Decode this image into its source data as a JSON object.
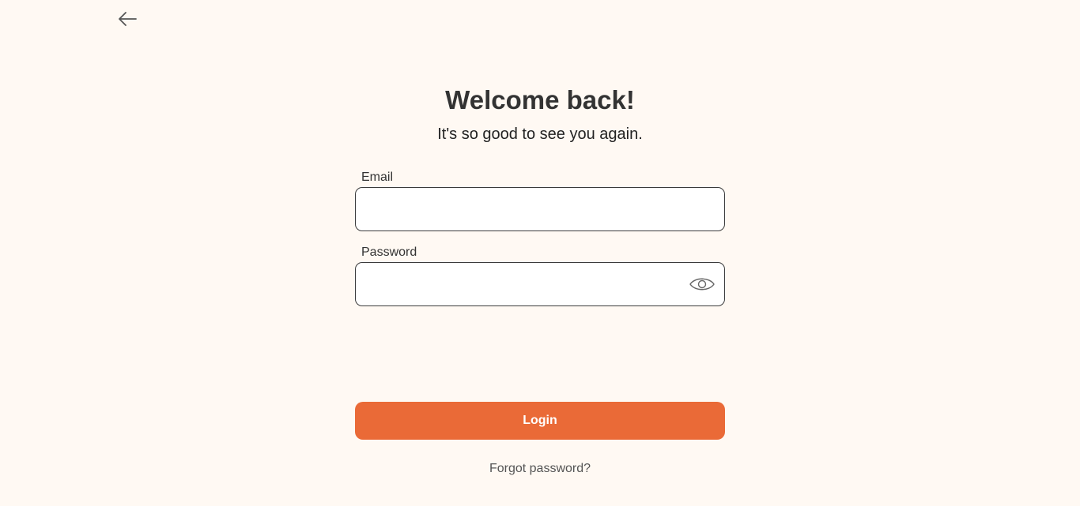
{
  "nav": {
    "back_icon": "arrow-left-icon"
  },
  "header": {
    "title": "Welcome back!",
    "subtitle": "It's so good to see you again."
  },
  "form": {
    "email": {
      "label": "Email",
      "value": "",
      "placeholder": ""
    },
    "password": {
      "label": "Password",
      "value": "",
      "placeholder": "",
      "toggle_icon": "eye-icon"
    },
    "login_label": "Login",
    "forgot_label": "Forgot password?"
  },
  "colors": {
    "background": "#fff9f3",
    "accent": "#ea6a37",
    "text": "#333333"
  }
}
